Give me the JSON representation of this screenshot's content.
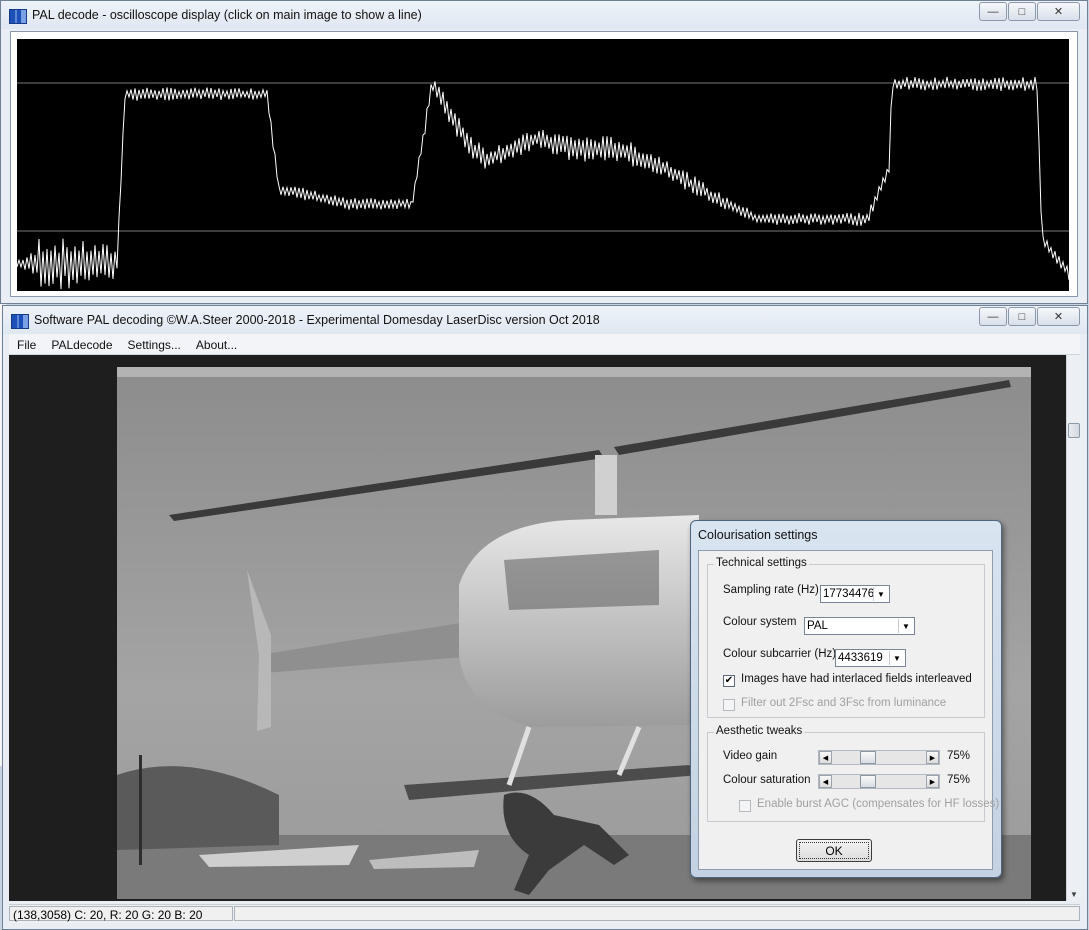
{
  "scope_window": {
    "title": "PAL decode - oscilloscope display (click on main image to show a line)",
    "waveform": {
      "signal_shape": "PAL composite video line with colour burst and bright/dark luminance regions",
      "trace_color": "#ffffff",
      "background_color": "#000000",
      "reference_lines": 2
    }
  },
  "main_window": {
    "title": "Software PAL decoding  ©W.A.Steer 2000-2018 - Experimental Domesday LaserDisc version Oct 2018",
    "menu": [
      "File",
      "PALdecode",
      "Settings...",
      "About..."
    ],
    "status": "(138,3058) C: 20, R: 20 G: 20 B: 20",
    "image_description": ""
  },
  "dialog": {
    "title": "Colourisation settings",
    "technical": {
      "label": "Technical settings",
      "sampling_rate_label": "Sampling rate (Hz)",
      "sampling_rate_value": "17734476",
      "colour_system_label": "Colour system",
      "colour_system_value": "PAL",
      "subcarrier_label": "Colour subcarrier (Hz)",
      "subcarrier_value": "4433619",
      "interlaced_label": "Images have had interlaced fields interleaved",
      "interlaced_checked": true,
      "filter_label": "Filter out 2Fsc and 3Fsc from luminance",
      "filter_checked": false
    },
    "aesthetic": {
      "label": "Aesthetic tweaks",
      "video_gain_label": "Video gain",
      "video_gain_value": "75%",
      "video_gain_level": 0.3,
      "saturation_label": "Colour saturation",
      "saturation_value": "75%",
      "saturation_level": 0.3,
      "burst_agc_label": "Enable burst AGC (compensates for HF losses)",
      "burst_agc_checked": false
    },
    "ok_label": "OK"
  },
  "colors": {
    "title_gradient": "#dfe7f1",
    "dialog_frame": "#c3d1e2",
    "dialog_body": "#f0f0f0"
  }
}
